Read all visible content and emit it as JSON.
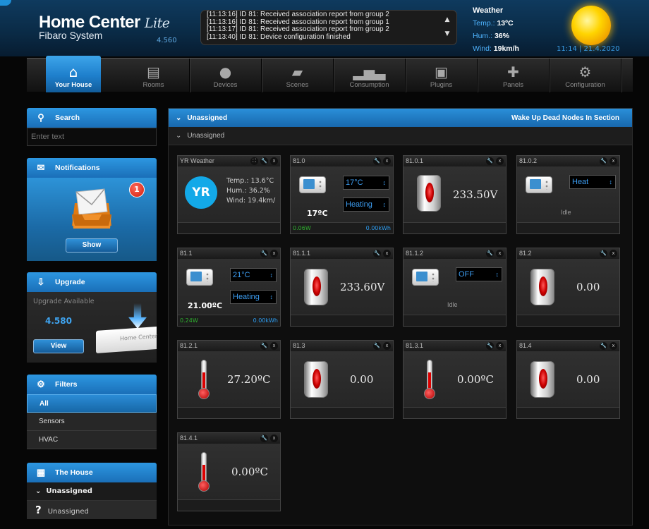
{
  "header": {
    "brand_title": "Home Center",
    "brand_lite": "Lite",
    "brand_sub": "Fibaro System",
    "version": "4.560",
    "log": [
      "[11:13:16] ID 81: Received association report from group 2",
      "[11:13:16] ID 81: Received association report from group 1",
      "[11:13:17] ID 81: Received association report from group 2",
      "[11:13:40] ID 81: Device configuration finished"
    ],
    "weather": {
      "title": "Weather",
      "temp_label": "Temp.:",
      "temp_value": "13ºC",
      "hum_label": "Hum.:",
      "hum_value": "36%",
      "wind_label": "Wind:",
      "wind_value": "19km/h",
      "clock": "11:14 | 21.4.2020",
      "icon": "sun-icon"
    }
  },
  "nav": [
    {
      "label": "Your House",
      "icon": "house-icon",
      "active": true
    },
    {
      "label": "Rooms",
      "icon": "rooms-icon"
    },
    {
      "label": "Devices",
      "icon": "bulb-icon"
    },
    {
      "label": "Scenes",
      "icon": "clapper-icon"
    },
    {
      "label": "Consumption",
      "icon": "chart-icon"
    },
    {
      "label": "Plugins",
      "icon": "plugin-icon"
    },
    {
      "label": "Panels",
      "icon": "puzzle-icon"
    },
    {
      "label": "Configuration",
      "icon": "gears-icon"
    }
  ],
  "sidebar": {
    "search": {
      "title": "Search",
      "placeholder": "Enter text"
    },
    "notifications": {
      "title": "Notifications",
      "badge": "1",
      "button": "Show"
    },
    "upgrade": {
      "title": "Upgrade",
      "available": "Upgrade Available",
      "version": "4.580",
      "button": "View",
      "box_text": "Home Center"
    },
    "filters": {
      "title": "Filters",
      "items": [
        "All",
        "Sensors",
        "HVAC"
      ],
      "selected": "All"
    },
    "house": {
      "title": "The House",
      "items": [
        "Unassigned",
        "Unassigned"
      ]
    }
  },
  "main": {
    "header_left": "Unassigned",
    "header_right": "Wake Up Dead Nodes In Section",
    "section": "Unassigned",
    "devices": {
      "yr": {
        "title": "YR Weather",
        "logo": "YR",
        "temp": "Temp.: 13.6°C",
        "hum": "Hum.: 36.2%",
        "wind": "Wind: 19.4km/"
      },
      "d81_0": {
        "title": "81.0",
        "setpoint": "17°C",
        "mode": "Heating",
        "reading": "17ºC",
        "power": "0.06W",
        "energy": "0.00kWh"
      },
      "d81_0_1": {
        "title": "81.0.1",
        "value": "233.50V"
      },
      "d81_0_2": {
        "title": "81.0.2",
        "mode": "Heat",
        "state": "Idle"
      },
      "d81_1": {
        "title": "81.1",
        "setpoint": "21°C",
        "mode": "Heating",
        "reading": "21.00ºC",
        "power": "0.24W",
        "energy": "0.00kWh"
      },
      "d81_1_1": {
        "title": "81.1.1",
        "value": "233.60V"
      },
      "d81_1_2": {
        "title": "81.1.2",
        "mode": "OFF",
        "state": "Idle"
      },
      "d81_2": {
        "title": "81.2",
        "value": "0.00"
      },
      "d81_2_1": {
        "title": "81.2.1",
        "value": "27.20ºC"
      },
      "d81_3": {
        "title": "81.3",
        "value": "0.00"
      },
      "d81_3_1": {
        "title": "81.3.1",
        "value": "0.00ºC"
      },
      "d81_4": {
        "title": "81.4",
        "value": "0.00"
      },
      "d81_4_1": {
        "title": "81.4.1",
        "value": "0.00ºC"
      }
    }
  },
  "colors": {
    "accent": "#1f7fcf",
    "value_blue": "#3c9cf0",
    "power_green": "#2fb02f",
    "energy_blue": "#2d9cf0"
  }
}
